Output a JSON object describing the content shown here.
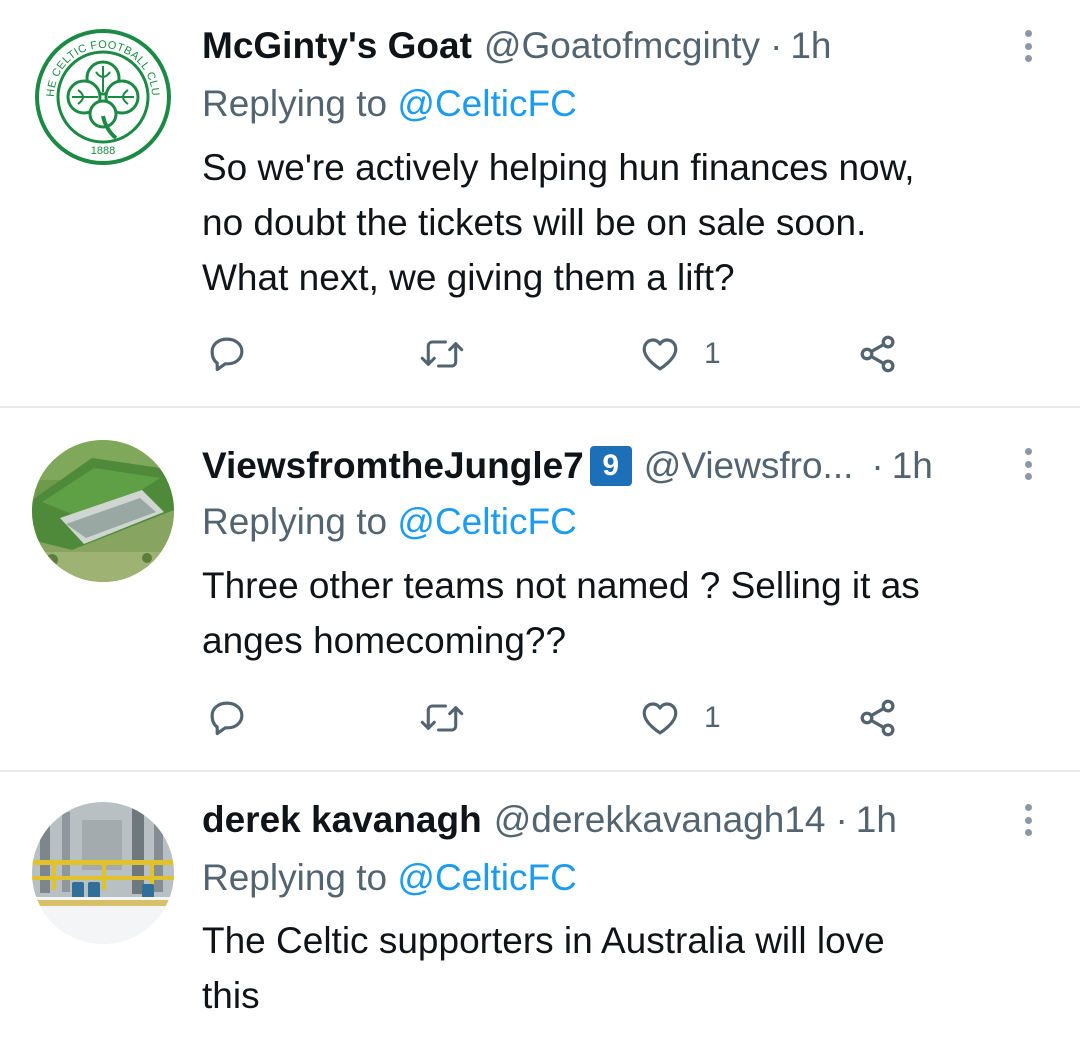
{
  "tweets": [
    {
      "display_name": "McGinty's Goat",
      "handle": "@Goatofmcginty",
      "separator": "·",
      "time": "1h",
      "badge": "",
      "replying_prefix": "Replying to ",
      "replying_to": "@CelticFC",
      "text_lines": [
        "So we're actively helping hun finances now,",
        "no doubt the tickets will be on sale soon.",
        "What next, we giving them a lift?"
      ],
      "like_count": "1",
      "avatar_icon": "celtic-crest-avatar",
      "avatar_text_top": "THE CELTIC FOOTBALL CLUB",
      "avatar_text_bottom": "1888"
    },
    {
      "display_name": "ViewsfromtheJungle7",
      "handle": "@Viewsfro...",
      "separator": "·",
      "time": "1h",
      "badge": "9",
      "replying_prefix": "Replying to ",
      "replying_to": "@CelticFC",
      "text_lines": [
        "Three other teams not named ? Selling it as",
        "anges homecoming??"
      ],
      "like_count": "1",
      "avatar_icon": "stadium-aerial-avatar"
    },
    {
      "display_name": "derek kavanagh",
      "handle": "@derekkavanagh14",
      "separator": "·",
      "time": "1h",
      "badge": "",
      "replying_prefix": "Replying to ",
      "replying_to": "@CelticFC",
      "text_lines": [
        "The Celtic supporters in Australia will love",
        "this"
      ],
      "avatar_icon": "industrial-plant-avatar"
    }
  ],
  "colors": {
    "text_primary": "#0f1419",
    "text_secondary": "#536471",
    "link": "#1d9bf0",
    "divider": "#e7e9ea",
    "badge": "#1d6fb8",
    "celtic_green": "#1c8a44"
  }
}
